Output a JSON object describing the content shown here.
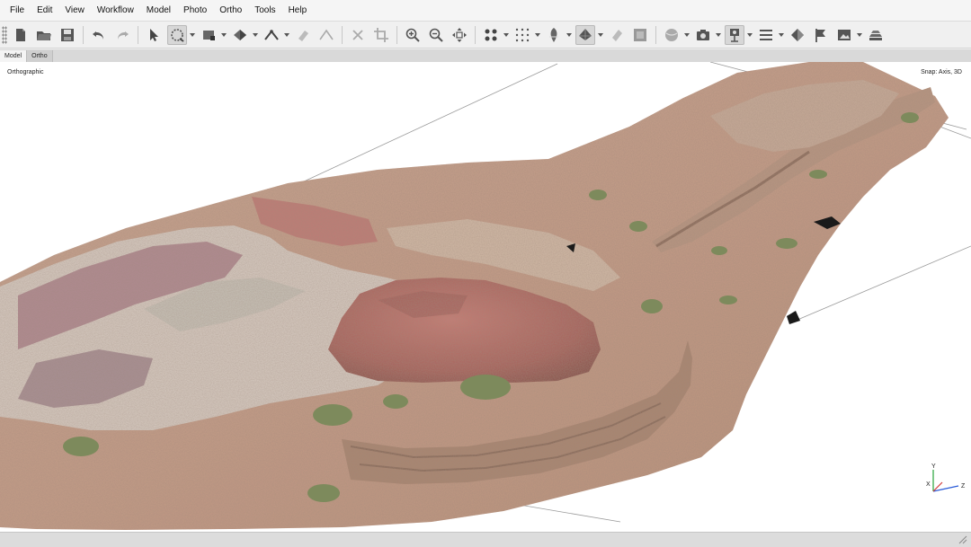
{
  "menu": [
    "File",
    "Edit",
    "View",
    "Workflow",
    "Model",
    "Photo",
    "Ortho",
    "Tools",
    "Help"
  ],
  "toolbar": {
    "icons": [
      "new-icon",
      "open-icon",
      "save-icon",
      "undo-icon",
      "redo-icon",
      "pointer-icon",
      "rotate-select-icon",
      "rect-select-icon",
      "shape-icon",
      "ruler-icon",
      "eraser-icon",
      "polyline-icon",
      "delete-icon",
      "crop-icon",
      "zoom-in-icon",
      "zoom-out-icon",
      "move-icon",
      "points-icon",
      "grid-points-icon",
      "dense-cloud-icon",
      "mesh-icon",
      "texture-icon",
      "tiled-icon",
      "sphere-icon",
      "camera-icon",
      "camera-stand-icon",
      "list-icon",
      "markers-icon",
      "flag-icon",
      "ortho-image-icon",
      "layers-icon"
    ]
  },
  "tabs": [
    {
      "label": "Model",
      "active": true
    },
    {
      "label": "Ortho",
      "active": false
    }
  ],
  "viewport": {
    "mode_label": "Orthographic",
    "snap_label": "Snap: Axis, 3D",
    "axes": {
      "y": "Y",
      "x": "X",
      "z": "Z"
    }
  },
  "colors": {
    "terrain": "#c9a28c",
    "rock_pink": "#b86d6a",
    "stone_wall": "#a98570",
    "pale_rock": "#d8cfc2",
    "bush": "#7d8a5c"
  }
}
